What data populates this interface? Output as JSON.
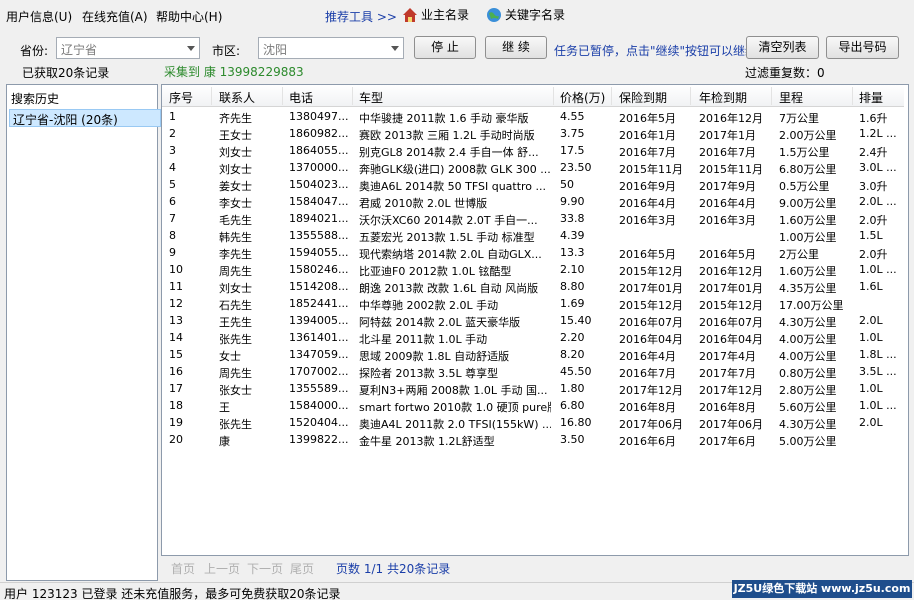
{
  "menu": {
    "user_info": "用户信息(U)",
    "recharge": "在线充值(A)",
    "help": "帮助中心(H)"
  },
  "tools": {
    "label": "推荐工具 >>",
    "owner_list": "业主名录",
    "keyword_list": "关键字名录"
  },
  "filters": {
    "province_label": "省份:",
    "province_value": "辽宁省",
    "city_label": "市区:",
    "city_value": "沈阳"
  },
  "actions": {
    "stop": "停 止",
    "continue": "继 续",
    "clear_list": "清空列表",
    "export_numbers": "导出号码"
  },
  "notice": "任务已暂停，点击\"继续\"按钮可以继续",
  "fetched_count": "已获取20条记录",
  "collecting": "采集到 康 13998229883",
  "duplicate_filter": "过滤重复数：0",
  "history": {
    "title": "搜索历史",
    "selected": "辽宁省-沈阳 (20条)"
  },
  "table": {
    "headers": [
      "序号",
      "联系人",
      "电话",
      "车型",
      "价格(万)",
      "保险到期",
      "年检到期",
      "里程",
      "排量"
    ],
    "rows": [
      [
        "1",
        "齐先生",
        "1380497...",
        "中华骏捷 2011款 1.6 手动 豪华版",
        "4.55",
        "2016年5月",
        "2016年12月",
        "7万公里",
        "1.6升"
      ],
      [
        "2",
        "王女士",
        "1860982...",
        "赛欧 2013款 三厢 1.2L 手动时尚版",
        "3.75",
        "2016年1月",
        "2017年1月",
        "2.00万公里",
        "1.2L ..."
      ],
      [
        "3",
        "刘女士",
        "1864055...",
        "别克GL8 2014款 2.4 手自一体 舒...",
        "17.5",
        "2016年7月",
        "2016年7月",
        "1.5万公里",
        "2.4升"
      ],
      [
        "4",
        "刘女士",
        "1370000...",
        "奔驰GLK级(进口) 2008款 GLK 300 ...",
        "23.50",
        "2015年11月",
        "2015年11月",
        "6.80万公里",
        "3.0L ..."
      ],
      [
        "5",
        "姜女士",
        "1504023...",
        "奥迪A6L 2014款 50 TFSI quattro ...",
        "50",
        "2016年9月",
        "2017年9月",
        "0.5万公里",
        "3.0升"
      ],
      [
        "6",
        "李女士",
        "1584047...",
        "君威 2010款 2.0L 世博版",
        "9.90",
        "2016年4月",
        "2016年4月",
        "9.00万公里",
        "2.0L ..."
      ],
      [
        "7",
        "毛先生",
        "1894021...",
        "沃尔沃XC60 2014款 2.0T 手自一...",
        "33.8",
        "2016年3月",
        "2016年3月",
        "1.60万公里",
        "2.0升"
      ],
      [
        "8",
        "韩先生",
        "1355588...",
        "五菱宏光 2013款 1.5L 手动 标准型",
        "4.39",
        "",
        "",
        "1.00万公里",
        "1.5L"
      ],
      [
        "9",
        "李先生",
        "1594055...",
        "现代索纳塔 2014款 2.0L 自动GLX...",
        "13.3",
        "2016年5月",
        "2016年5月",
        "2万公里",
        "2.0升"
      ],
      [
        "10",
        "周先生",
        "1580246...",
        "比亚迪F0 2012款 1.0L 铉酷型",
        "2.10",
        "2015年12月",
        "2016年12月",
        "1.60万公里",
        "1.0L ..."
      ],
      [
        "11",
        "刘女士",
        "1514208...",
        "朗逸 2013款 改款 1.6L 自动 风尚版",
        "8.80",
        "2017年01月",
        "2017年01月",
        "4.35万公里",
        "1.6L"
      ],
      [
        "12",
        "石先生",
        "1852441...",
        "中华尊驰 2002款 2.0L 手动",
        "1.69",
        "2015年12月",
        "2015年12月",
        "17.00万公里",
        ""
      ],
      [
        "13",
        "王先生",
        "1394005...",
        "阿特兹 2014款 2.0L 蓝天豪华版",
        "15.40",
        "2016年07月",
        "2016年07月",
        "4.30万公里",
        "2.0L"
      ],
      [
        "14",
        "张先生",
        "1361401...",
        "北斗星 2011款 1.0L 手动",
        "2.20",
        "2016年04月",
        "2016年04月",
        "4.00万公里",
        "1.0L"
      ],
      [
        "15",
        "女士",
        "1347059...",
        "思域 2009款 1.8L 自动舒适版",
        "8.20",
        "2016年4月",
        "2017年4月",
        "4.00万公里",
        "1.8L ..."
      ],
      [
        "16",
        "周先生",
        "1707002...",
        "探险者 2013款 3.5L 尊享型",
        "45.50",
        "2016年7月",
        "2017年7月",
        "0.80万公里",
        "3.5L ..."
      ],
      [
        "17",
        "张女士",
        "1355589...",
        "夏利N3+两厢 2008款 1.0L 手动 国...",
        "1.80",
        "2017年12月",
        "2017年12月",
        "2.80万公里",
        "1.0L"
      ],
      [
        "18",
        "王",
        "1584000...",
        "smart fortwo 2010款 1.0 硬顶 pure版",
        "6.80",
        "2016年8月",
        "2016年8月",
        "5.60万公里",
        "1.0L ..."
      ],
      [
        "19",
        "张先生",
        "1520404...",
        "奥迪A4L 2011款 2.0 TFSI(155kW) ...",
        "16.80",
        "2017年06月",
        "2017年06月",
        "4.30万公里",
        "2.0L"
      ],
      [
        "20",
        "康",
        "1399822...",
        "金牛星 2013款 1.2L舒适型",
        "3.50",
        "2016年6月",
        "2017年6月",
        "5.00万公里",
        ""
      ]
    ]
  },
  "pager": {
    "first": "首页",
    "prev": "上一页",
    "next": "下一页",
    "last": "尾页",
    "info": "页数 1/1 共20条记录"
  },
  "status": "用户 123123 已登录 还未充值服务，最多可免费获取20条记录",
  "watermark": "JZ5U绿色下载站 www.jz5u.com",
  "colors": {
    "accent_blue": "#1a3ea8",
    "green_text": "#2c8a2c",
    "selection": "#cde8ff"
  },
  "icons": {
    "owner_list": "house-icon",
    "keyword_list": "globe-icon"
  }
}
